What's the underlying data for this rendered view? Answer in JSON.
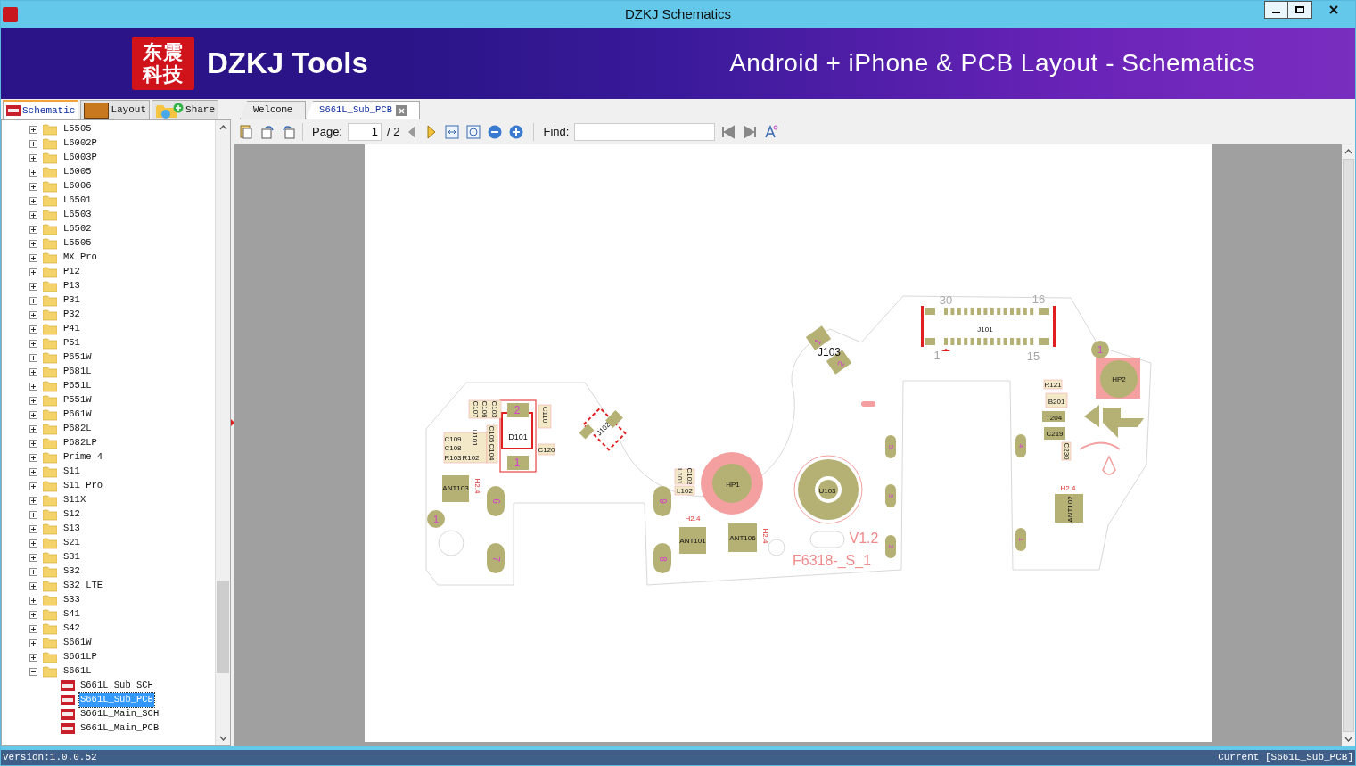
{
  "window": {
    "title": "DZKJ Schematics"
  },
  "banner": {
    "logo": [
      "东震",
      "科技"
    ],
    "brand": "DZKJ Tools",
    "tagline": "Android + iPhone & PCB Layout - Schematics"
  },
  "side_tabs": [
    {
      "label": "Schematic",
      "kind": "pdf",
      "selected": true
    },
    {
      "label": "Layout",
      "kind": "pads",
      "selected": false
    },
    {
      "label": "Share",
      "kind": "share",
      "selected": false
    }
  ],
  "doc_tabs": [
    {
      "label": "Welcome",
      "selected": false
    },
    {
      "label": "S661L_Sub_PCB",
      "selected": true
    }
  ],
  "toolbar": {
    "page_label": "Page:",
    "page_value": "1",
    "page_total": "/ 2",
    "find_label": "Find:"
  },
  "tree": [
    {
      "label": "L5505",
      "expanded": false
    },
    {
      "label": "L6002P",
      "expanded": false
    },
    {
      "label": "L6003P",
      "expanded": false
    },
    {
      "label": "L6005",
      "expanded": false
    },
    {
      "label": "L6006",
      "expanded": false
    },
    {
      "label": "L6501",
      "expanded": false
    },
    {
      "label": "L6503",
      "expanded": false
    },
    {
      "label": "L6502",
      "expanded": false
    },
    {
      "label": "L5505",
      "expanded": false
    },
    {
      "label": "MX Pro",
      "expanded": false
    },
    {
      "label": "P12",
      "expanded": false
    },
    {
      "label": "P13",
      "expanded": false
    },
    {
      "label": "P31",
      "expanded": false
    },
    {
      "label": "P32",
      "expanded": false
    },
    {
      "label": "P41",
      "expanded": false
    },
    {
      "label": "P51",
      "expanded": false
    },
    {
      "label": "P651W",
      "expanded": false
    },
    {
      "label": "P681L",
      "expanded": false
    },
    {
      "label": "P651L",
      "expanded": false
    },
    {
      "label": "P551W",
      "expanded": false
    },
    {
      "label": "P661W",
      "expanded": false
    },
    {
      "label": "P682L",
      "expanded": false
    },
    {
      "label": "P682LP",
      "expanded": false
    },
    {
      "label": "Prime 4",
      "expanded": false
    },
    {
      "label": "S11",
      "expanded": false
    },
    {
      "label": "S11 Pro",
      "expanded": false
    },
    {
      "label": "S11X",
      "expanded": false
    },
    {
      "label": "S12",
      "expanded": false
    },
    {
      "label": "S13",
      "expanded": false
    },
    {
      "label": "S21",
      "expanded": false
    },
    {
      "label": "S31",
      "expanded": false
    },
    {
      "label": "S32",
      "expanded": false
    },
    {
      "label": "S32 LTE",
      "expanded": false
    },
    {
      "label": "S33",
      "expanded": false
    },
    {
      "label": "S41",
      "expanded": false
    },
    {
      "label": "S42",
      "expanded": false
    },
    {
      "label": "S661W",
      "expanded": false
    },
    {
      "label": "S661LP",
      "expanded": false
    },
    {
      "label": "S661L",
      "expanded": true,
      "children": [
        {
          "label": "S661L_Sub_SCH",
          "selected": false
        },
        {
          "label": "S661L_Sub_PCB",
          "selected": true
        },
        {
          "label": "S661L_Main_SCH",
          "selected": false
        },
        {
          "label": "S661L_Main_PCB",
          "selected": false
        }
      ]
    }
  ],
  "pcb_labels": [
    "30",
    "16",
    "J101",
    "1",
    "15",
    "J103",
    "1",
    "2",
    "2",
    "D101",
    "1",
    "HP1",
    "HP2",
    "ANT103",
    "ANT101",
    "ANT106",
    "ANT102",
    "U103",
    "B201",
    "V1.2",
    "F6318-_S_1",
    "H2.4",
    "H2.4",
    "H2.4",
    "H2.4",
    "9",
    "7",
    "6",
    "8",
    "5",
    "3",
    "2",
    "4",
    "1",
    "1",
    "1",
    "C107",
    "C106",
    "C103",
    "C110",
    "C109",
    "C108",
    "R103",
    "R102",
    "C105",
    "C104",
    "U101",
    "C120",
    "L101",
    "C102",
    "L102",
    "R121",
    "T204",
    "C219",
    "C230",
    "J102"
  ],
  "status_bar": {
    "version": "Version:1.0.0.52",
    "current": "Current [S661L_Sub_PCB]"
  }
}
